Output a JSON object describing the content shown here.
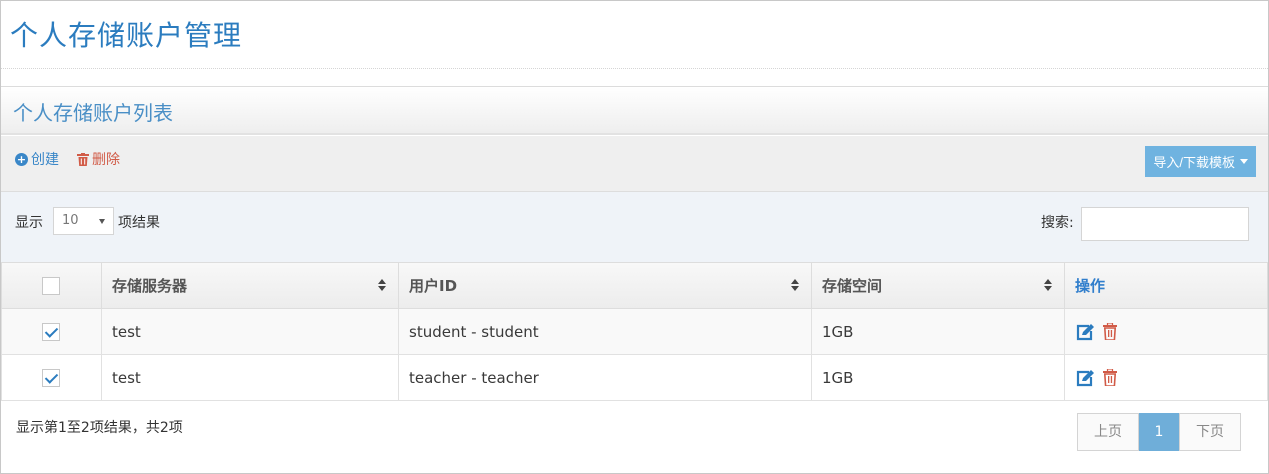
{
  "page": {
    "title": "个人存储账户管理"
  },
  "panel": {
    "title": "个人存储账户列表"
  },
  "toolbar": {
    "create_label": "创建",
    "delete_label": "删除",
    "import_label": "导入/下载模板"
  },
  "list_controls": {
    "show_label": "显示",
    "page_size": "10",
    "results_label": "项结果",
    "search_label": "搜索:",
    "search_value": ""
  },
  "table": {
    "headers": [
      "存储服务器",
      "用户ID",
      "存储空间",
      "操作"
    ],
    "rows": [
      {
        "checked": true,
        "server": "test",
        "user_id": "student - student",
        "storage": "1GB"
      },
      {
        "checked": true,
        "server": "test",
        "user_id": "teacher - teacher",
        "storage": "1GB"
      }
    ]
  },
  "footer": {
    "info": "显示第1至2项结果，共2项",
    "prev": "上页",
    "current_page": "1",
    "next": "下页"
  },
  "colors": {
    "accent": "#2b7cbf",
    "danger": "#d15b47",
    "button": "#6fb3e0"
  }
}
